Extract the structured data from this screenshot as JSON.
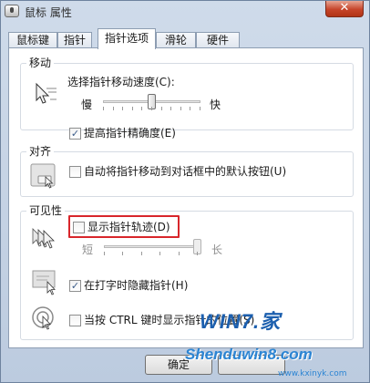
{
  "window": {
    "title": "鼠标 属性",
    "close_glyph": "✕"
  },
  "tabs": [
    {
      "label": "鼠标键",
      "active": false
    },
    {
      "label": "指针",
      "active": false
    },
    {
      "label": "指针选项",
      "active": true
    },
    {
      "label": "滑轮",
      "active": false
    },
    {
      "label": "硬件",
      "active": false
    }
  ],
  "motion": {
    "title": "移动",
    "speed_label": "选择指针移动速度(C):",
    "slow": "慢",
    "fast": "快",
    "speed_value": 0.5,
    "precision_label": "提高指针精确度(E)",
    "precision_checked": true
  },
  "snap": {
    "title": "对齐",
    "snap_label": "自动将指针移动到对话框中的默认按钮(U)",
    "snap_checked": false
  },
  "visibility": {
    "title": "可见性",
    "trails_label": "显示指针轨迹(D)",
    "trails_checked": false,
    "short": "短",
    "long": "长",
    "trail_value": 1.0,
    "hide_typing_label": "在打字时隐藏指针(H)",
    "hide_typing_checked": true,
    "ctrl_label": "当按 CTRL 键时显示指针的位置(S)",
    "ctrl_checked": false
  },
  "buttons": {
    "ok": "确定"
  },
  "watermark": {
    "logo": "WIN7.家",
    "text": "Shenduwin8.com",
    "url": "www.kxinyk.com"
  },
  "icons": {
    "app": "mouse-properties-icon",
    "speed": "pointer-speed-icon",
    "snap": "snap-to-icon",
    "trails": "pointer-trails-icon",
    "hide": "hide-pointer-icon",
    "ctrl": "locate-pointer-icon"
  },
  "colors": {
    "highlight": "#d8262b",
    "window_frame": "#bccbdf"
  }
}
